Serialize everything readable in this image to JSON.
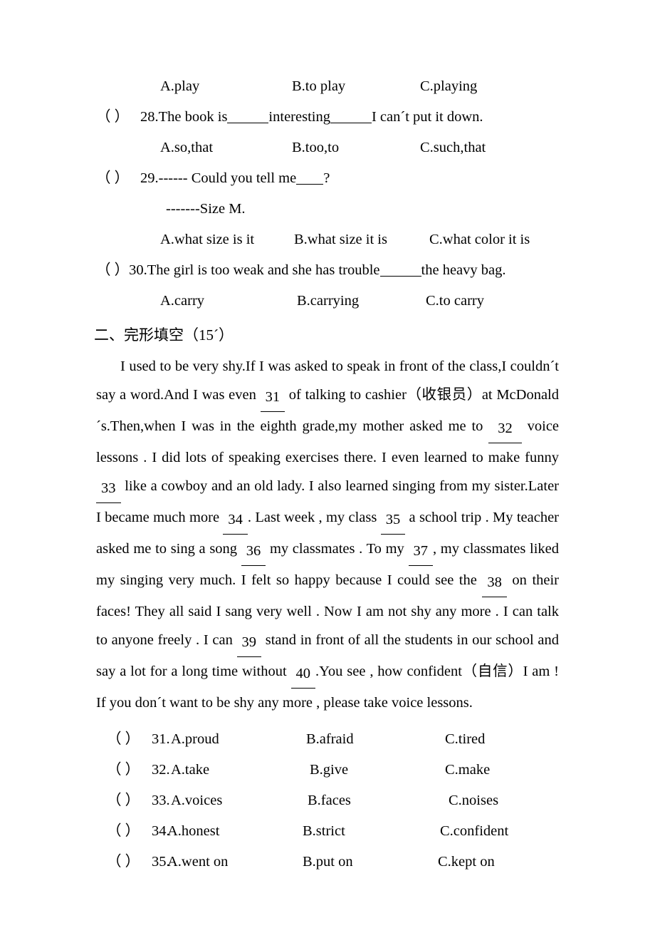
{
  "document": {
    "type": "english-exam-worksheet",
    "language": "en-zh",
    "background_color": "#ffffff",
    "text_color": "#000000"
  },
  "grammar_section": {
    "q27_options": {
      "a": "A.play",
      "b": "B.to play",
      "c": "C.playing"
    },
    "q28": {
      "paren": "（    ）",
      "number": "28.",
      "text_before": "The book is",
      "text_middle": "interesting",
      "text_after": "I can´t put it down.",
      "options": {
        "a": "A.so,that",
        "b": "B.too,to",
        "c": "C.such,that"
      }
    },
    "q29": {
      "paren": "（    ）",
      "number": "29.",
      "text_before": "------ Could you tell me",
      "text_after": "?",
      "answer_line": "-------Size M.",
      "options": {
        "a": "A.what size is it",
        "b": "B.what size it is",
        "c": "C.what color it is"
      }
    },
    "q30": {
      "paren": "（    ）",
      "number": "30.",
      "text_before": "The girl is too weak and she has trouble",
      "text_after": "the heavy bag.",
      "options": {
        "a": "A.carry",
        "b": "B.carrying",
        "c": "C.to carry"
      }
    }
  },
  "cloze_section": {
    "heading": "二、完形填空（15´）",
    "passage": {
      "part1": "I used to be very shy.If I was asked to speak in front of the class,I couldn´t say a word.And I was even",
      "blank31": "31",
      "part2": "of talking to cashier（收银员）at McDonald´s.Then,when I was in the eighth grade,my mother asked me to",
      "blank32": "32",
      "part3": "voice lessons . I did lots of speaking exercises there. I even learned to make funny",
      "blank33": "33",
      "part4": "like a cowboy and an old lady. I also learned singing from my sister.Later I became much more",
      "blank34": "34",
      "part5": ". Last week , my class",
      "blank35": "35",
      "part6": "a school trip . My teacher asked me to sing a song",
      "blank36": "36",
      "part7": "my classmates . To my",
      "blank37": "37",
      "part8": ", my classmates liked my singing very much. I felt so happy because I could see the",
      "blank38": "38",
      "part9": "on their faces! They all said I sang very well . Now I am not shy any more . I can talk to anyone freely . I can",
      "blank39": "39",
      "part10": "stand in front of all the students in our school and say a lot for a long time without",
      "blank40": "40",
      "part11": ".You    see , how confident（自信）I am ! If you don´t want to be shy any more , please take voice lessons."
    },
    "options": [
      {
        "paren": "（   ）",
        "number": "31.",
        "a": "A.proud",
        "b": "B.afraid",
        "c": "C.tired"
      },
      {
        "paren": "（   ）",
        "number": "32.",
        "a": "A.take",
        "b": "B.give",
        "c": "C.make"
      },
      {
        "paren": "（   ）",
        "number": "33.",
        "a": "A.voices",
        "b": "B.faces",
        "c": "C.noises"
      },
      {
        "paren": "（   ）",
        "number": "34.",
        "a": "A.honest",
        "b": "B.strict",
        "c": "C.confident"
      },
      {
        "paren": "（   ）",
        "number": "35.",
        "a": "A.went on",
        "b": "B.put on",
        "c": "C.kept on"
      }
    ]
  }
}
